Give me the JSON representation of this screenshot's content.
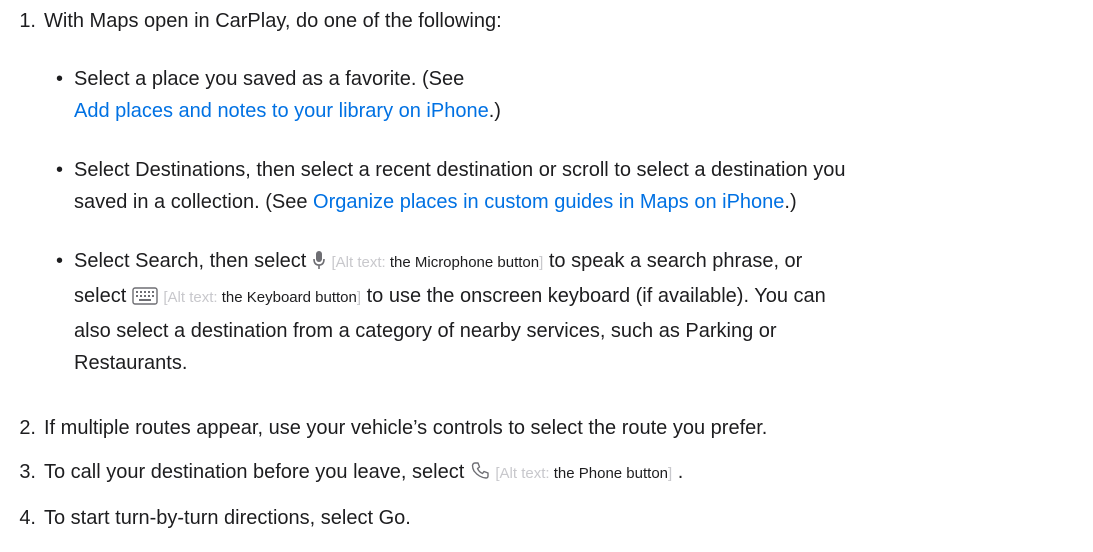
{
  "steps": [
    {
      "number": "1.",
      "text": "With Maps open in CarPlay, do one of the following:"
    },
    {
      "number": "2.",
      "text": "If multiple routes appear, use your vehicle’s controls to select the route you prefer."
    },
    {
      "number": "3.",
      "text_before": "To call your destination before you leave, select",
      "alt_value": "the Phone button",
      "text_after": "."
    },
    {
      "number": "4.",
      "text": "To start turn-by-turn directions, select Go."
    }
  ],
  "alt_prefix": "[Alt text: ",
  "alt_suffix": "]",
  "bullets": {
    "b1": {
      "line1": "Select a place you saved as a favorite. (See",
      "link": "Add places and notes to your library on iPhone",
      "after": ".)"
    },
    "b2": {
      "line1": "Select Destinations, then select a recent destination or scroll to select a destination you",
      "line2_before": "saved in a collection. (See ",
      "link": "Organize places in custom guides in Maps on iPhone",
      "after": ".)"
    },
    "b3": {
      "l1_before": "Select Search, then select",
      "l1_alt": "the Microphone button",
      "l1_after": "to speak a search phrase, or",
      "l2_before": "select",
      "l2_alt": "the Keyboard button",
      "l2_after": "to use the onscreen keyboard (if available). You can",
      "l3": "also select a destination from a category of nearby services, such as Parking or",
      "l4": "Restaurants."
    }
  },
  "icons": {
    "microphone": "microphone-icon",
    "keyboard": "keyboard-icon",
    "phone": "phone-icon"
  },
  "colors": {
    "text": "#1d1d1f",
    "link": "#0071e3",
    "alt_text": "#c8c8cc"
  }
}
